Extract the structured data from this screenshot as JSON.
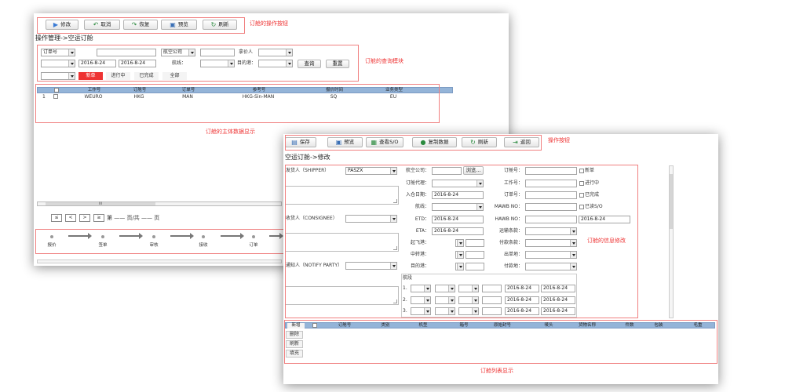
{
  "win1": {
    "toolbar": [
      "修改",
      "取消",
      "恢复",
      "预览",
      "刷新"
    ],
    "breadcrumb": "操作管理->空运订舱",
    "query": {
      "order_type": "订单号",
      "airline_label": "航空公司",
      "quoter_label": "拿价人",
      "date_from": "2016-8-24",
      "date_to": "2016-8-24",
      "route_label": "航线：",
      "dest_label": "目的港：",
      "search": "查询",
      "reset": "重置"
    },
    "tabs": [
      "新单",
      "进行中",
      "已完成",
      "全部"
    ],
    "table": {
      "headers": [
        "工作号",
        "订舱号",
        "订单号",
        "参考号",
        "报价时间",
        "业务类型"
      ],
      "row": {
        "num": "1",
        "job": "WEURO",
        "booking": "HKG",
        "order": "MAN",
        "ref": "HKG-Sin-MAN",
        "quote": "SQ",
        "type": "EU"
      }
    },
    "pager": {
      "first": "≤",
      "prev": "<",
      "next": ">",
      "last": "≥",
      "page_text": "第 —— 页/共 —— 页"
    },
    "steps": [
      "报价",
      "签单",
      "审核",
      "接收",
      "订单"
    ],
    "scroll_mark": "III"
  },
  "win2": {
    "toolbar": [
      "保存",
      "预览",
      "查看S/O",
      "复制数据",
      "刷新",
      "返回"
    ],
    "breadcrumb": "空运订舱->修改",
    "shipper_label": "发货人（SHIPPER）",
    "shipper_value": "PASZX",
    "consignee_label": "收货人（CONSIGNEE）",
    "notify_label": "通知人（NOTIFY PARTY）",
    "mid": {
      "airline": "航空公司：",
      "browse": "浏览...",
      "agent": "订舱代理：",
      "entry_date": "入仓日期：",
      "entry_date_value": "2016-8-24",
      "route": "航线：",
      "etd": "ETD：",
      "etd_value": "2016-8-24",
      "eta": "ETA：",
      "eta_value": "2016-8-24",
      "depart_port": "起飞港：",
      "transit_port": "中转港：",
      "dest_port": "目的港："
    },
    "right": {
      "booking_no": "订舱号：",
      "job_no": "工作号：",
      "order_no": "订单号：",
      "mawb": "MAWB NO：",
      "hawb": "HAWB NO：",
      "transport_terms": "运输条款：",
      "payment_terms": "付款条款：",
      "issue_place": "出单地：",
      "payment_place": "付款地：",
      "hawb_date": "2016-8-24"
    },
    "status": [
      "新单",
      "进行中",
      "已完成",
      "已读S/O"
    ],
    "segment_label": "航段",
    "segments": [
      {
        "n": "1.",
        "d1": "2016-8-24",
        "d2": "2016-8-24"
      },
      {
        "n": "2.",
        "d1": "2016-8-24",
        "d2": "2016-8-24"
      },
      {
        "n": "3.",
        "d1": "2016-8-24",
        "d2": "2016-8-24"
      }
    ],
    "list": {
      "buttons": [
        "新增",
        "删除",
        "刷新",
        "填充"
      ],
      "headers": [
        "订舱号",
        "类别",
        "机型",
        "箱号",
        "原始封号",
        "唛头",
        "货物名称",
        "件数",
        "包装",
        "毛重"
      ]
    }
  },
  "annotations": {
    "a1": "订舱的操作按钮",
    "a2": "订舱的查询模块",
    "a3": "订舱的主体数据显示",
    "a4": "操作按钮",
    "a5": "订舱的信息修改",
    "a6": "订舱列表显示"
  },
  "colors": {
    "annotation": "#ee3333",
    "table_header": "#94b4d8",
    "tab_active": "#ee3333"
  }
}
